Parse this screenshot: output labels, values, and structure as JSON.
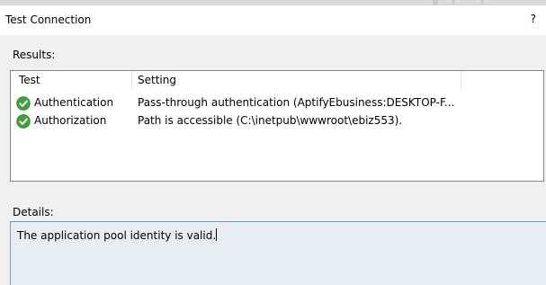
{
  "dialog": {
    "title": "Test Connection",
    "help_glyph": "?"
  },
  "results": {
    "label": "Results:",
    "columns": [
      "Test",
      "Setting"
    ],
    "rows": [
      {
        "status_icon": "check-circle-icon",
        "test": "Authentication",
        "setting": "Pass-through authentication (AptifyEbusiness:DESKTOP-F..."
      },
      {
        "status_icon": "check-circle-icon",
        "test": "Authorization",
        "setting": "Path is accessible (C:\\inetpub\\wwwroot\\ebiz553)."
      }
    ]
  },
  "details": {
    "label": "Details:",
    "text": "The application pool identity is valid."
  },
  "colors": {
    "success_green": "#39a539",
    "details_background": "#e8edf2",
    "details_border": "#7a9ab8"
  }
}
